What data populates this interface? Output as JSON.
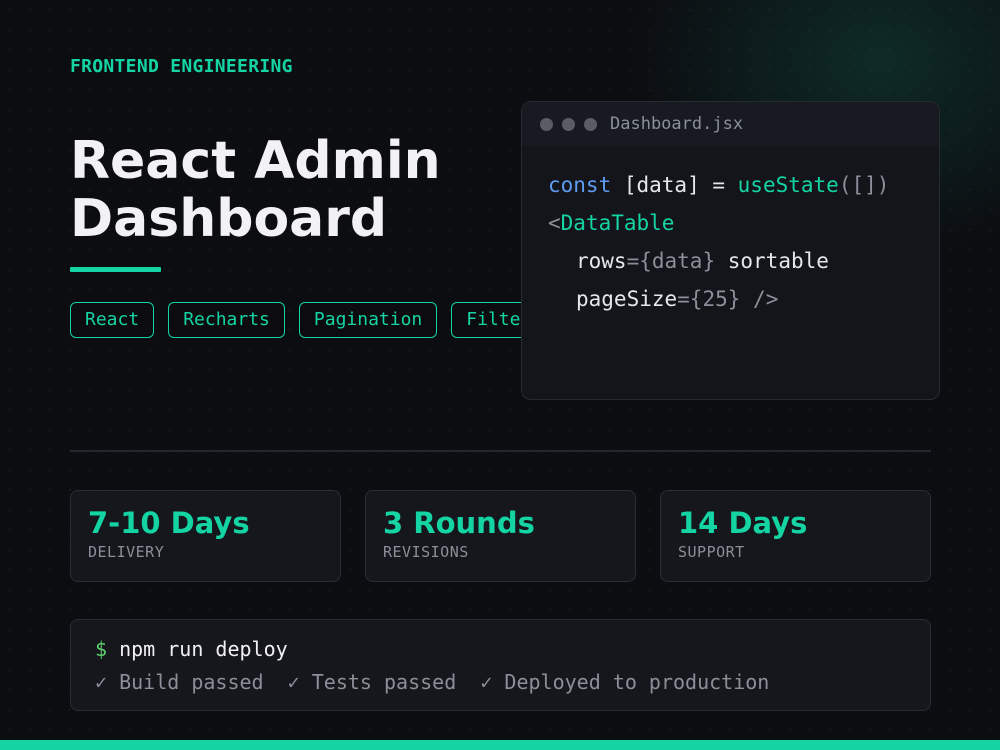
{
  "eyebrow": "FRONTEND ENGINEERING",
  "title": {
    "line1": "React Admin",
    "line2": "Dashboard"
  },
  "tags": [
    "React",
    "Recharts",
    "Pagination",
    "Filters"
  ],
  "code_window": {
    "filename": "Dashboard.jsx",
    "lines": {
      "l1": {
        "kw": "const",
        "mid": " [data] = ",
        "fn": "useState",
        "end": "([])"
      },
      "l2": {
        "lt": "<",
        "comp": "DataTable"
      },
      "l3": {
        "attr": "rows",
        "eq": "={",
        "val": "data",
        "close": "}",
        "rest": " sortable"
      },
      "l4": {
        "attr": "pageSize",
        "eq": "={",
        "val": "25",
        "close": "}",
        "end": " />"
      }
    }
  },
  "stats": [
    {
      "value": "7-10 Days",
      "label": "DELIVERY"
    },
    {
      "value": "3 Rounds",
      "label": "REVISIONS"
    },
    {
      "value": "14 Days",
      "label": "SUPPORT"
    }
  ],
  "terminal": {
    "prompt": "$",
    "command": "npm run deploy",
    "results": [
      "✓ Build passed",
      "✓ Tests passed",
      "✓ Deployed to production"
    ]
  },
  "colors": {
    "accent": "#14d4a4",
    "background": "#0c0d11",
    "keyword": "#5f9bf0",
    "muted": "#8b8f99",
    "prompt": "#5fcf6e"
  }
}
